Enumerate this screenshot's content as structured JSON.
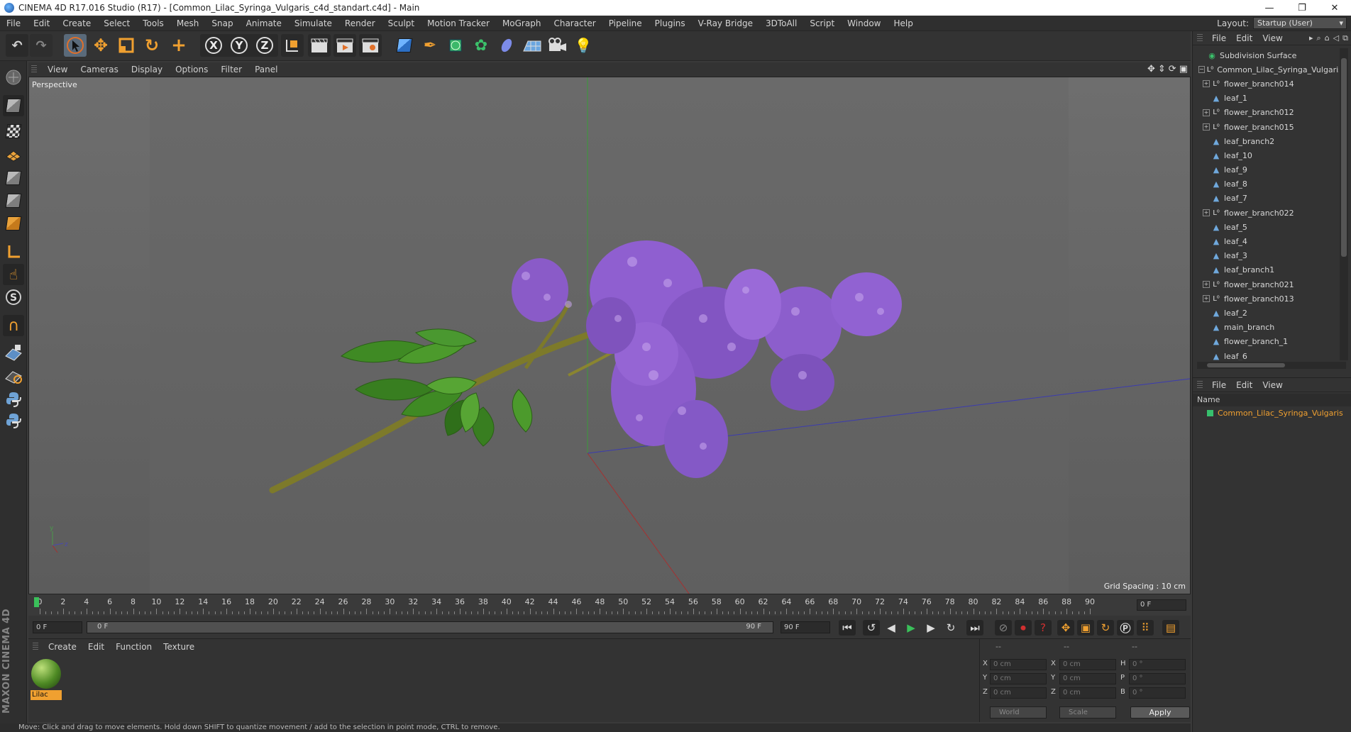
{
  "window": {
    "title": "CINEMA 4D R17.016 Studio (R17) - [Common_Lilac_Syringa_Vulgaris_c4d_standart.c4d] - Main",
    "buttons": [
      "—",
      "❐",
      "✕"
    ]
  },
  "menubar": {
    "items": [
      "File",
      "Edit",
      "Create",
      "Select",
      "Tools",
      "Mesh",
      "Snap",
      "Animate",
      "Simulate",
      "Render",
      "Sculpt",
      "Motion Tracker",
      "MoGraph",
      "Character",
      "Pipeline",
      "Plugins",
      "V-Ray Bridge",
      "3DToAll",
      "Script",
      "Window",
      "Help"
    ],
    "layout_label": "Layout:",
    "layout_value": "Startup (User)"
  },
  "toolbar": {
    "axis_labels": [
      "X",
      "Y",
      "Z"
    ]
  },
  "viewport": {
    "menu": [
      "View",
      "Cameras",
      "Display",
      "Options",
      "Filter",
      "Panel"
    ],
    "label": "Perspective",
    "grid_spacing": "Grid Spacing : 10 cm",
    "axis_y": "y",
    "axis_z": "z"
  },
  "timeline": {
    "ticks": [
      "0",
      "2",
      "4",
      "6",
      "8",
      "10",
      "12",
      "14",
      "16",
      "18",
      "20",
      "22",
      "24",
      "26",
      "28",
      "30",
      "32",
      "34",
      "36",
      "38",
      "40",
      "42",
      "44",
      "46",
      "48",
      "50",
      "52",
      "54",
      "56",
      "58",
      "60",
      "62",
      "64",
      "66",
      "68",
      "70",
      "72",
      "74",
      "76",
      "78",
      "80",
      "82",
      "84",
      "86",
      "88",
      "90"
    ],
    "current_frame": "0 F"
  },
  "transport": {
    "start": "0 F",
    "slider_start": "0 F",
    "slider_end": "90 F",
    "end": "90 F"
  },
  "materials": {
    "menu": [
      "Create",
      "Edit",
      "Function",
      "Texture"
    ],
    "items": [
      {
        "name": "Lilac"
      }
    ]
  },
  "coordinates": {
    "header": [
      "--",
      "--",
      "--"
    ],
    "rows": [
      {
        "a1": "X",
        "v1": "0 cm",
        "a2": "X",
        "v2": "0 cm",
        "a3": "H",
        "v3": "0 °"
      },
      {
        "a1": "Y",
        "v1": "0 cm",
        "a2": "Y",
        "v2": "0 cm",
        "a3": "P",
        "v3": "0 °"
      },
      {
        "a1": "Z",
        "v1": "0 cm",
        "a2": "Z",
        "v2": "0 cm",
        "a3": "B",
        "v3": "0 °"
      }
    ],
    "dropdown1": "World",
    "dropdown2": "Scale",
    "apply": "Apply"
  },
  "status": "Move: Click and drag to move elements. Hold down SHIFT to quantize movement / add to the selection in point mode, CTRL to remove.",
  "object_manager": {
    "menu": [
      "File",
      "Edit",
      "View"
    ],
    "objects": [
      {
        "name": "Subdivision Surface",
        "type": "subdiv",
        "indent": 0,
        "expand": ""
      },
      {
        "name": "Common_Lilac_Syringa_Vulgaris",
        "type": "null",
        "indent": 0,
        "expand": "−"
      },
      {
        "name": "flower_branch014",
        "type": "null",
        "indent": 1,
        "expand": "+"
      },
      {
        "name": "leaf_1",
        "type": "poly",
        "indent": 1,
        "expand": ""
      },
      {
        "name": "flower_branch012",
        "type": "null",
        "indent": 1,
        "expand": "+"
      },
      {
        "name": "flower_branch015",
        "type": "null",
        "indent": 1,
        "expand": "+"
      },
      {
        "name": "leaf_branch2",
        "type": "poly",
        "indent": 1,
        "expand": ""
      },
      {
        "name": "leaf_10",
        "type": "poly",
        "indent": 1,
        "expand": ""
      },
      {
        "name": "leaf_9",
        "type": "poly",
        "indent": 1,
        "expand": ""
      },
      {
        "name": "leaf_8",
        "type": "poly",
        "indent": 1,
        "expand": ""
      },
      {
        "name": "leaf_7",
        "type": "poly",
        "indent": 1,
        "expand": ""
      },
      {
        "name": "flower_branch022",
        "type": "null",
        "indent": 1,
        "expand": "+"
      },
      {
        "name": "leaf_5",
        "type": "poly",
        "indent": 1,
        "expand": ""
      },
      {
        "name": "leaf_4",
        "type": "poly",
        "indent": 1,
        "expand": ""
      },
      {
        "name": "leaf_3",
        "type": "poly",
        "indent": 1,
        "expand": ""
      },
      {
        "name": "leaf_branch1",
        "type": "poly",
        "indent": 1,
        "expand": ""
      },
      {
        "name": "flower_branch021",
        "type": "null",
        "indent": 1,
        "expand": "+"
      },
      {
        "name": "flower_branch013",
        "type": "null",
        "indent": 1,
        "expand": "+"
      },
      {
        "name": "leaf_2",
        "type": "poly",
        "indent": 1,
        "expand": ""
      },
      {
        "name": "main_branch",
        "type": "poly",
        "indent": 1,
        "expand": ""
      },
      {
        "name": "flower_branch_1",
        "type": "poly",
        "indent": 1,
        "expand": ""
      },
      {
        "name": "leaf_6",
        "type": "poly",
        "indent": 1,
        "expand": ""
      }
    ]
  },
  "layer_manager": {
    "menu": [
      "File",
      "Edit",
      "View"
    ],
    "column": "Name",
    "items": [
      {
        "name": "Common_Lilac_Syringa_Vulgaris",
        "color": "#37c06d"
      }
    ]
  },
  "colors": {
    "accent": "#f0a030",
    "material_label_bg": "#f0a030",
    "playhead": "#3ac05a"
  }
}
